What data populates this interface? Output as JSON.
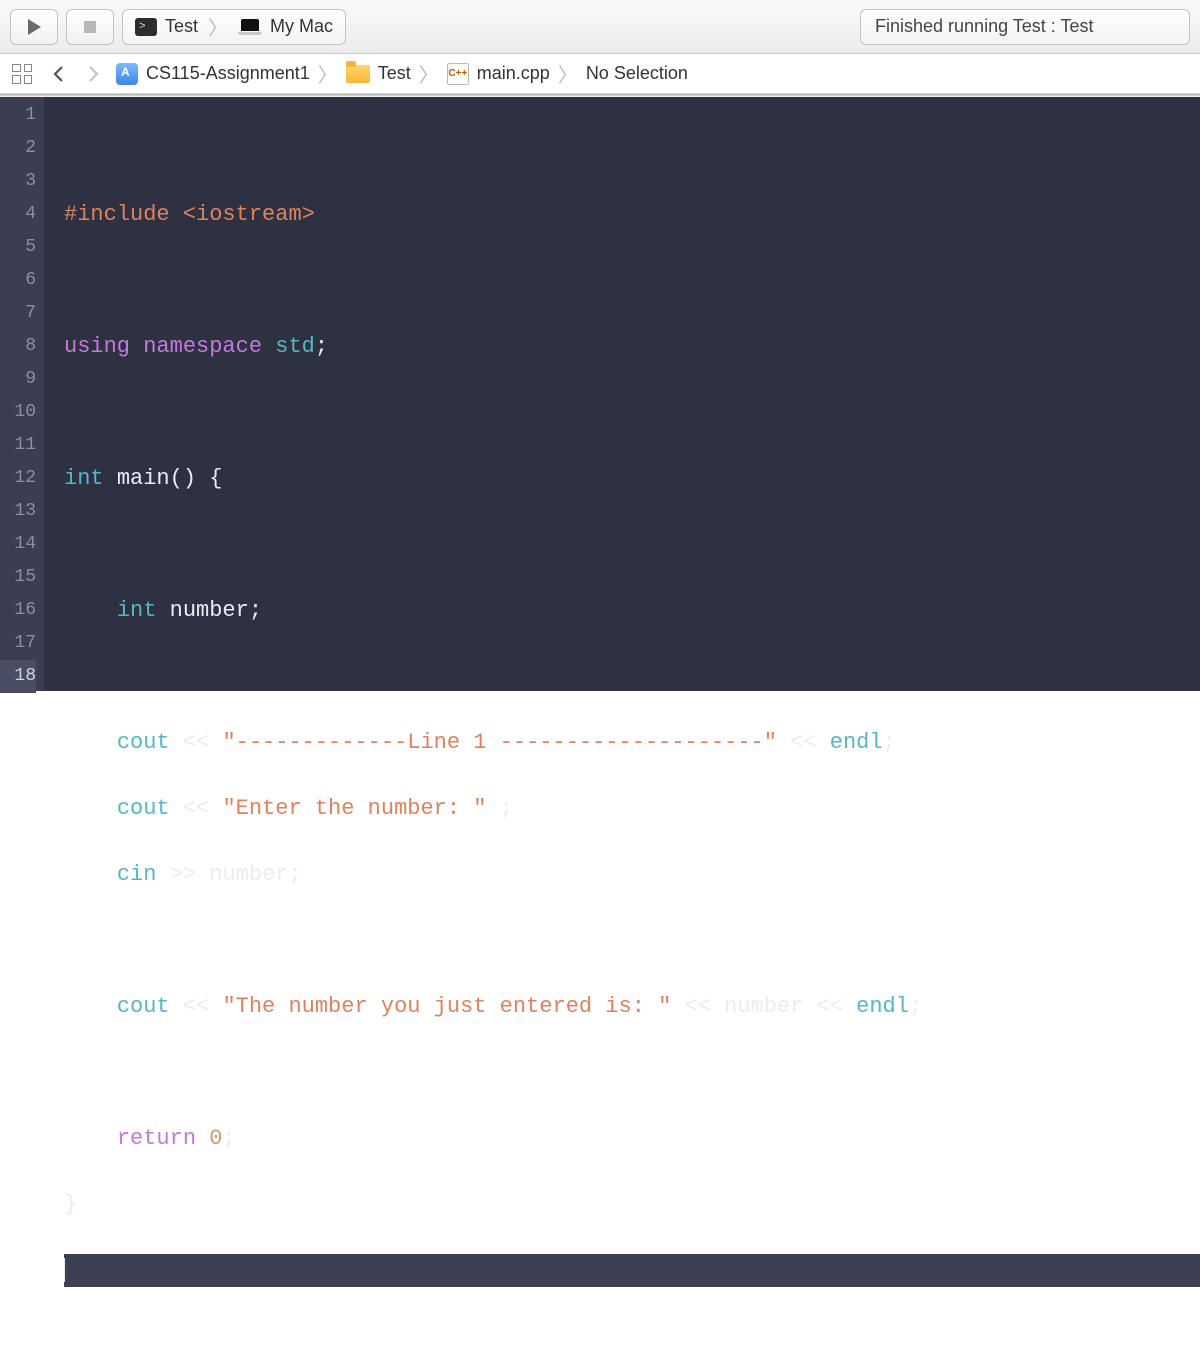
{
  "toolbar": {
    "scheme_target": "Test",
    "scheme_device": "My Mac",
    "status_text": "Finished running Test : Test"
  },
  "breadcrumb": {
    "project": "CS115-Assignment1",
    "folder": "Test",
    "file": "main.cpp",
    "selection": "No Selection",
    "cpp_badge": "C++"
  },
  "editor": {
    "line_count": 18,
    "current_line": 18,
    "tokens": {
      "l2_include": "#include",
      "l2_header": "<iostream>",
      "l4_using": "using",
      "l4_namespace": "namespace",
      "l4_std": "std",
      "l6_int": "int",
      "l6_main": "main",
      "l8_int": "int",
      "l8_number": "number",
      "l10_cout": "cout",
      "l10_str": "\"-------------Line 1 --------------------\"",
      "l10_endl": "endl",
      "l11_cout": "cout",
      "l11_str": "\"Enter the number: \"",
      "l12_cin": "cin",
      "l12_number": "number",
      "l14_cout": "cout",
      "l14_str": "\"The number you just entered is: \"",
      "l14_number": "number",
      "l14_endl": "endl",
      "l16_return": "return",
      "l16_zero": "0"
    }
  }
}
